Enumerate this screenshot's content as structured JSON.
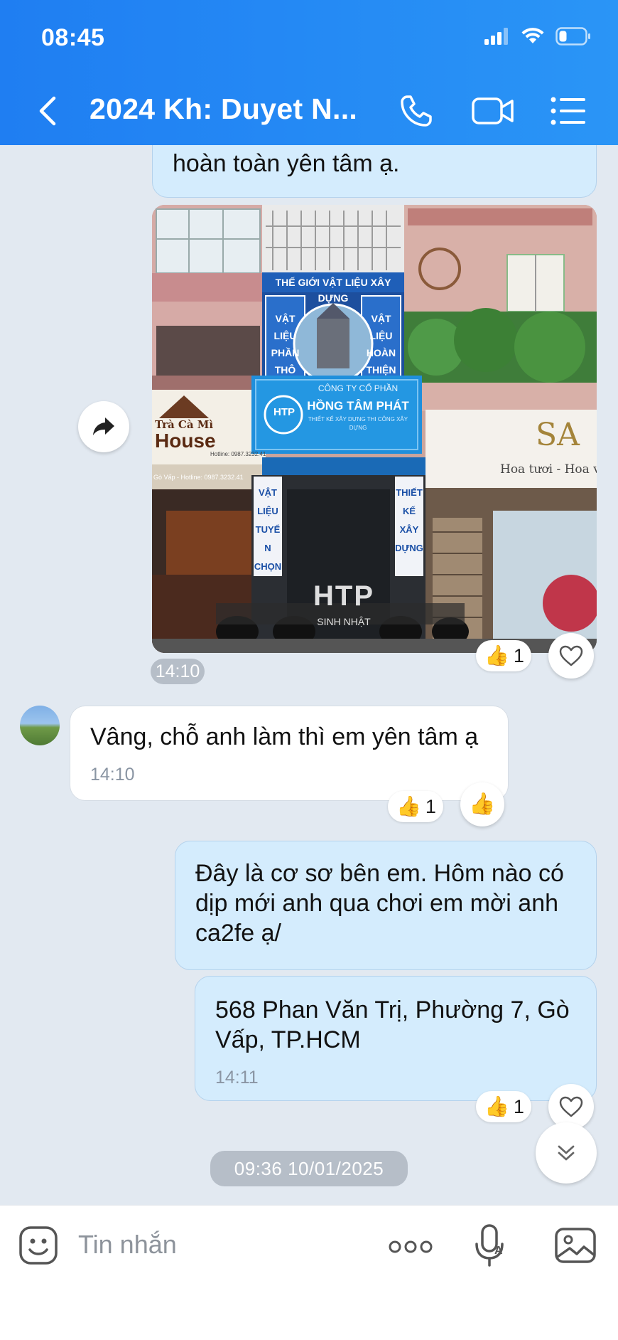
{
  "status_bar": {
    "time": "08:45"
  },
  "header": {
    "title": "2024 Kh: Duyet N...",
    "back_icon": "chevron-left-icon",
    "actions": [
      "phone-icon",
      "video-call-icon",
      "menu-list-icon"
    ]
  },
  "messages": {
    "m1": {
      "direction": "outgoing",
      "text": "hoàn toàn yên tâm ạ."
    },
    "photo": {
      "sign_top": "THẾ GIỚI VẬT LIỆU XÂY DỰNG",
      "sign_left": "VẬT LIỆU PHẦN THÔ",
      "sign_right": "VẬT LIỆU HOÀN THIỆN",
      "company_line": "CÔNG TY CỔ PHẦN",
      "company_name": "HỒNG TÂM PHÁT",
      "company_sub": "THIẾT KẾ XÂY DỰNG THI CÔNG XÂY DỰNG",
      "left_shop_top": "Trà Cà Mì",
      "left_shop_name": "House",
      "left_shop_phone": "Hotline: 0987.3232.41",
      "left_shop_area": "Gò Vấp - Hotline: 0987.3232.41",
      "right_shop_name": "SA",
      "right_shop_sub": "Hoa tươi - Hoa vải",
      "logo": "HTP",
      "watermark": "SINH NHẬT",
      "door_left": "VẬT LIỆU TUYỂN CHỌN",
      "door_right": "THIẾT KẾ XÂY DỰNG",
      "time": "14:10",
      "reaction": {
        "emoji": "👍",
        "count": "1"
      }
    },
    "m2": {
      "direction": "incoming",
      "text": "Vâng, chỗ anh làm thì em yên tâm ạ",
      "time": "14:10",
      "reaction": {
        "emoji": "👍",
        "count": "1"
      }
    },
    "m3": {
      "direction": "outgoing",
      "text": "Đây là cơ sơ bên em. Hôm nào có dịp mới anh qua chơi em mời anh ca2fe ạ/"
    },
    "m4": {
      "direction": "outgoing",
      "text": "568 Phan Văn Trị, Phường 7, Gò Vấp, TP.HCM",
      "time": "14:11",
      "reaction": {
        "emoji": "👍",
        "count": "1"
      }
    }
  },
  "date_divider": "09:36 10/01/2025",
  "input": {
    "placeholder": "Tin nhắn",
    "icons": [
      "sticker-icon",
      "more-dots-icon",
      "voice-mic-icon",
      "image-gallery-icon"
    ]
  },
  "colors": {
    "header_start": "#1f7ef2",
    "header_end": "#2a95f6",
    "outgoing_bubble": "#d4ecfd",
    "chat_bg": "#e2e9f1"
  }
}
